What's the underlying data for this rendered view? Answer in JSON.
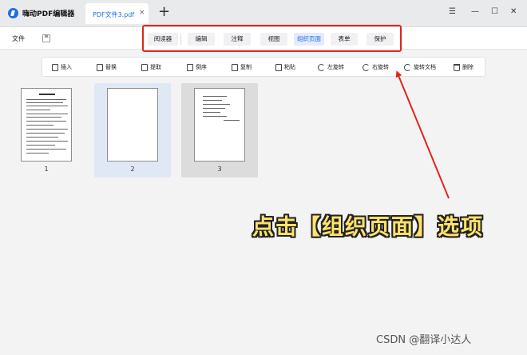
{
  "app": {
    "title": "嗨动PDF编辑器"
  },
  "tab": {
    "label": "PDF文件3.pdf",
    "close": "×",
    "new": "+"
  },
  "window_controls": {
    "menu": "☰",
    "minimize": "—",
    "maximize": "☐",
    "close": "✕"
  },
  "menubar": {
    "file_label": "文件"
  },
  "main_tabs": [
    {
      "label": "阅读器",
      "active": false
    },
    {
      "label": "编辑",
      "active": false
    },
    {
      "label": "注释",
      "active": false
    },
    {
      "label": "视图",
      "active": false
    },
    {
      "label": "组织页面",
      "active": true
    },
    {
      "label": "表单",
      "active": false
    },
    {
      "label": "保护",
      "active": false
    }
  ],
  "toolbar": {
    "insert": "插入",
    "replace": "替换",
    "extract": "提取",
    "reverse": "倒序",
    "copy": "复制",
    "paste": "粘贴",
    "rotate_left": "左旋转",
    "rotate_right": "右旋转",
    "rotate_doc": "旋转文档",
    "delete": "删除"
  },
  "pages": [
    {
      "number": "1",
      "state": "normal"
    },
    {
      "number": "2",
      "state": "selected"
    },
    {
      "number": "3",
      "state": "hover"
    }
  ],
  "annotation": {
    "callout": "点击【组织页面】选项",
    "color": "#ffe36a",
    "highlight_color": "#e0251c"
  },
  "watermark": "CSDN @翻译小达人",
  "colors": {
    "accent": "#1f6fe0",
    "toolbar_bg": "#ffffff",
    "workspace_bg": "#f3f3f3"
  }
}
